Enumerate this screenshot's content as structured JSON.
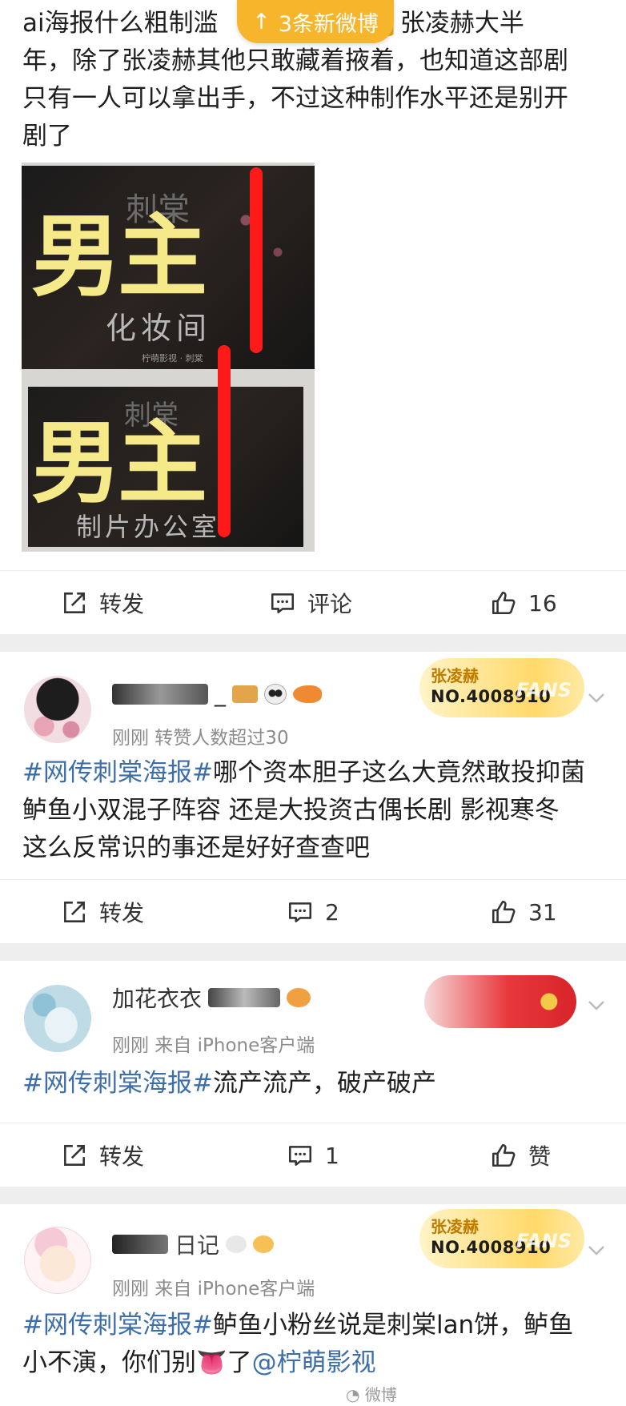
{
  "banner": {
    "label": "3条新微博"
  },
  "post1": {
    "text_lines": [
      "ai海报什么粗制滥",
      "🔒张凌赫大半",
      "年，除了张凌赫其他只敢藏着掖着，也知道这部剧",
      "只有一人可以拿出手，不过这种制作水平还是别开",
      "剧了"
    ],
    "image": {
      "top_overlay": "男主",
      "bottom_overlay": "男主",
      "top_caption": "化妆间",
      "bottom_caption": "制片办公室",
      "brand": "柠萌影视 · 刺棠"
    },
    "actions": {
      "repost": "转发",
      "comment": "评论",
      "like_count": "16"
    }
  },
  "comment1": {
    "username_visible": "_",
    "meta": "刚刚  转赞人数超过30",
    "fans_badge": {
      "name": "张凌赫",
      "number": "NO.4008910",
      "word": "FANS"
    },
    "topic": "#网传刺棠海报#",
    "text_lines": [
      "哪个资本胆子这么大竟然敢投抑菌",
      "鲈鱼小双混子阵容 还是大投资古偶长剧 影视寒冬",
      "这么反常识的事还是好好查查吧"
    ],
    "actions": {
      "repost": "转发",
      "comment_count": "2",
      "like_count": "31"
    }
  },
  "comment2": {
    "username_visible": "加花衣衣",
    "meta": "刚刚  来自 iPhone客户端",
    "topic": "#网传刺棠海报#",
    "text": "流产流产，破产破产",
    "actions": {
      "repost": "转发",
      "comment_count": "1",
      "like_label": "赞"
    }
  },
  "comment3": {
    "username_visible": "日记",
    "meta": "刚刚  来自 iPhone客户端",
    "fans_badge": {
      "name": "张凌赫",
      "number": "NO.4008910",
      "word": "FANS"
    },
    "topic": "#网传刺棠海报#",
    "text_line1": "鲈鱼小粉丝说是刺棠lan饼，鲈鱼",
    "text_line2_a": "小不演，你们别",
    "text_line2_b": "了",
    "mention": "@柠萌影视",
    "watermark": "微博"
  },
  "colors": {
    "topic": "#3d6ea8",
    "banner": "#f7b52c",
    "fans_badge": "#ffd96a",
    "overlay_text": "#f6e98a",
    "red_line": "#ff1a1a"
  }
}
